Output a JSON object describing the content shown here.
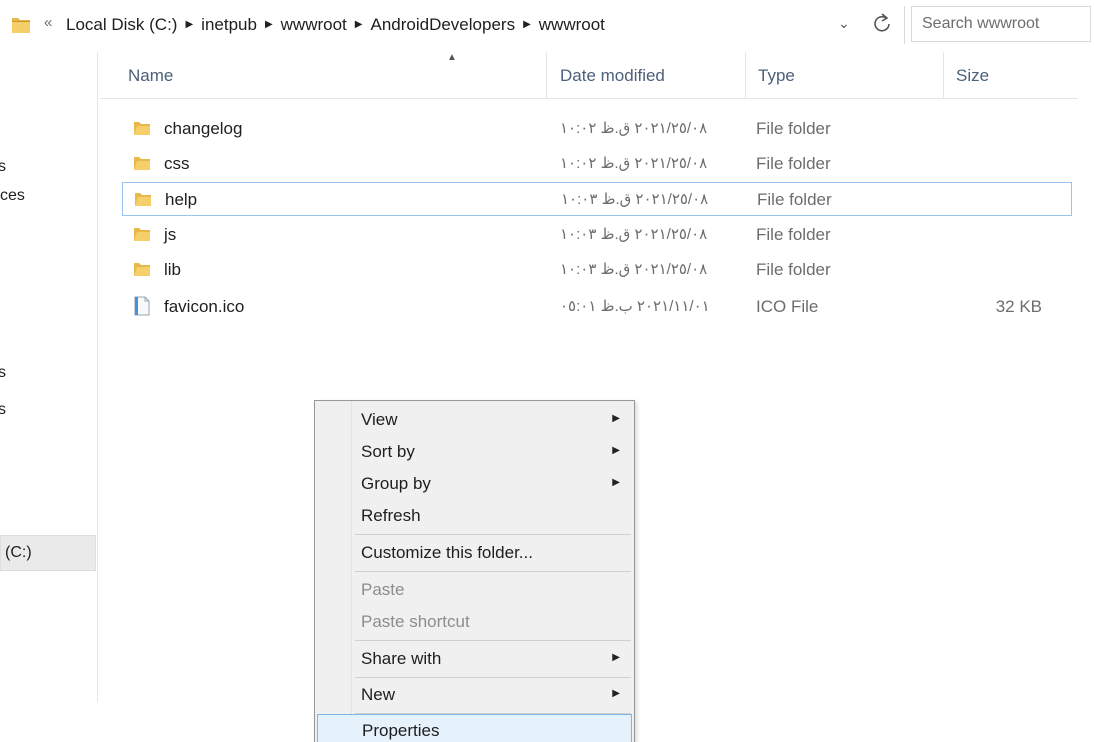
{
  "address": {
    "overflow_chevron": "«",
    "breadcrumbs": [
      "Local Disk (C:)",
      "inetpub",
      "wwwroot",
      "AndroidDevelopers",
      "wwwroot"
    ],
    "search_placeholder": "Search wwwroot"
  },
  "nav_pane": {
    "items": [
      "s",
      "ces",
      "s",
      "s",
      "(C:)"
    ],
    "selected_item": "(C:)"
  },
  "columns": {
    "name": "Name",
    "date_modified": "Date modified",
    "type": "Type",
    "size": "Size",
    "sorted_by": "Name"
  },
  "files": [
    {
      "name": "changelog",
      "date": "٢٠٢١/٢٥/٠٨ ق.ظ ١٠:٠٢",
      "type": "File folder",
      "size": "",
      "icon": "folder-icon"
    },
    {
      "name": "css",
      "date": "٢٠٢١/٢٥/٠٨ ق.ظ ١٠:٠٢",
      "type": "File folder",
      "size": "",
      "icon": "folder-icon"
    },
    {
      "name": "help",
      "date": "٢٠٢١/٢٥/٠٨ ق.ظ ١٠:٠٣",
      "type": "File folder",
      "size": "",
      "icon": "folder-icon"
    },
    {
      "name": "js",
      "date": "٢٠٢١/٢٥/٠٨ ق.ظ ١٠:٠٣",
      "type": "File folder",
      "size": "",
      "icon": "folder-icon"
    },
    {
      "name": "lib",
      "date": "٢٠٢١/٢٥/٠٨ ق.ظ ١٠:٠٣",
      "type": "File folder",
      "size": "",
      "icon": "folder-icon"
    },
    {
      "name": "favicon.ico",
      "date": "٢٠٢١/١١/٠١ ب.ظ ٠٥:٠١",
      "type": "ICO File",
      "size": "32 KB",
      "icon": "ico-file-icon"
    }
  ],
  "focused_file": "help",
  "context_menu": {
    "items": [
      {
        "label": "View",
        "submenu": true,
        "enabled": true
      },
      {
        "label": "Sort by",
        "submenu": true,
        "enabled": true
      },
      {
        "label": "Group by",
        "submenu": true,
        "enabled": true
      },
      {
        "label": "Refresh",
        "submenu": false,
        "enabled": true
      },
      {
        "label": "Customize this folder...",
        "submenu": false,
        "enabled": true
      },
      {
        "label": "Paste",
        "submenu": false,
        "enabled": false
      },
      {
        "label": "Paste shortcut",
        "submenu": false,
        "enabled": false
      },
      {
        "label": "Share with",
        "submenu": true,
        "enabled": true
      },
      {
        "label": "New",
        "submenu": true,
        "enabled": true
      },
      {
        "label": "Properties",
        "submenu": false,
        "enabled": true
      }
    ],
    "highlighted_item": "Properties",
    "submenu_arrow": "▶"
  },
  "colors": {
    "folder": "#e8b84a",
    "column_header_text": "#4c607a",
    "focus_border": "#99c4ee",
    "menu_highlight_bg": "#e5f1fb",
    "menu_highlight_border": "#7eb4ea",
    "menu_bg": "#f0f0f0"
  }
}
